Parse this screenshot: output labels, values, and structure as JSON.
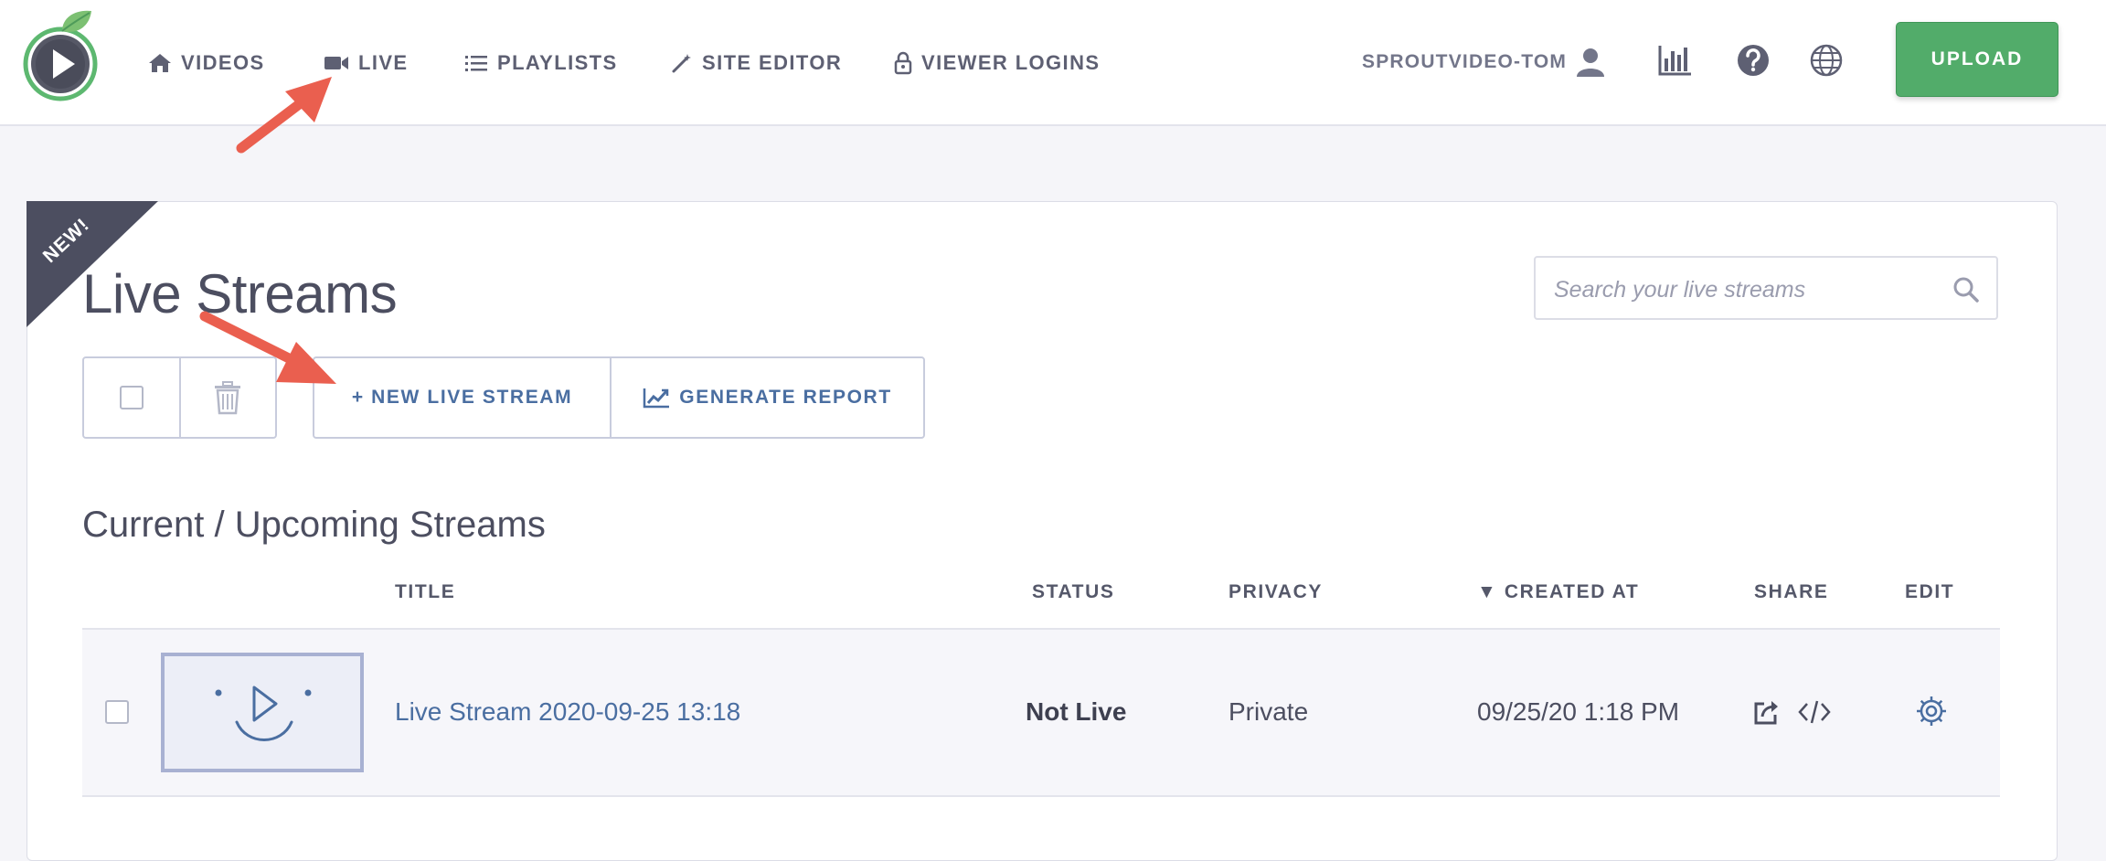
{
  "nav": {
    "items": [
      {
        "label": "VIDEOS",
        "icon": "home-icon"
      },
      {
        "label": "LIVE",
        "icon": "video-camera-icon"
      },
      {
        "label": "PLAYLISTS",
        "icon": "list-icon"
      },
      {
        "label": "SITE EDITOR",
        "icon": "magic-wand-icon"
      },
      {
        "label": "VIEWER LOGINS",
        "icon": "lock-icon"
      }
    ],
    "account": "SPROUTVIDEO-TOM",
    "upload_label": "UPLOAD"
  },
  "colors": {
    "accent": "#4a6ea1",
    "upload_green": "#52ac6a",
    "ribbon": "#4c4e60",
    "annotation_arrow": "#ea5f4f"
  },
  "page": {
    "badge": "NEW!",
    "title": "Live Streams",
    "search_placeholder": "Search your live streams"
  },
  "actions": {
    "new_stream": "+ NEW LIVE STREAM",
    "generate_report": "GENERATE REPORT"
  },
  "section": {
    "title": "Current / Upcoming Streams"
  },
  "table": {
    "headers": {
      "title": "TITLE",
      "status": "STATUS",
      "privacy": "PRIVACY",
      "created": "▼ CREATED AT",
      "share": "SHARE",
      "edit": "EDIT"
    },
    "rows": [
      {
        "title": "Live Stream 2020-09-25 13:18",
        "status": "Not Live",
        "privacy": "Private",
        "created": "09/25/20 1:18 PM"
      }
    ]
  }
}
